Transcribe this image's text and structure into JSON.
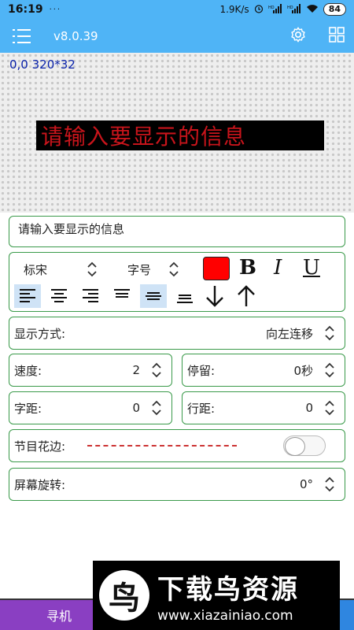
{
  "status_bar": {
    "time": "16:19",
    "speed": "1.9K/s",
    "battery": "84",
    "icons": [
      "alarm-icon",
      "signal-hd-icon",
      "signal-hd-icon",
      "wifi-icon",
      "battery-icon"
    ]
  },
  "toolbar": {
    "version": "v8.0.39",
    "icons": [
      "menu-icon",
      "settings-gear-icon",
      "grid-icon"
    ]
  },
  "preview": {
    "coords": "0,0 320*32",
    "led_text": "请输入要显示的信息",
    "led_color": "#c8141b"
  },
  "message": {
    "text": "请输入要显示的信息"
  },
  "style": {
    "font_name": "标宋",
    "font_size_label": "字号",
    "text_color": "#ff0000",
    "bold_label": "B",
    "italic_label": "I",
    "underline_label": "U",
    "align_buttons": [
      "align-left-icon",
      "align-center-icon",
      "align-right-icon",
      "align-top-icon",
      "align-middle-icon",
      "align-bottom-icon",
      "arrow-down-icon",
      "arrow-up-icon"
    ],
    "selected_align": [
      "align-left-icon",
      "align-middle-icon"
    ]
  },
  "display_mode": {
    "label": "显示方式:",
    "value": "向左连移"
  },
  "speed": {
    "label": "速度:",
    "value": "2"
  },
  "stay": {
    "label": "停留:",
    "value": "0秒"
  },
  "char_spacing": {
    "label": "字距:",
    "value": "0"
  },
  "line_spacing": {
    "label": "行距:",
    "value": "0"
  },
  "border": {
    "label": "节目花边:",
    "enabled": false
  },
  "rotation": {
    "label": "屏幕旋转:",
    "value": "0°"
  },
  "bottom_bar": {
    "buttons": [
      {
        "label": "寻机",
        "color": "#8a3fc2"
      },
      {
        "label": "",
        "color": "#3a9a4a"
      },
      {
        "label": "",
        "color": "#2f86e0"
      }
    ]
  },
  "watermark": {
    "title": "下载鸟资源",
    "url": "www.xiazainiao.com"
  }
}
